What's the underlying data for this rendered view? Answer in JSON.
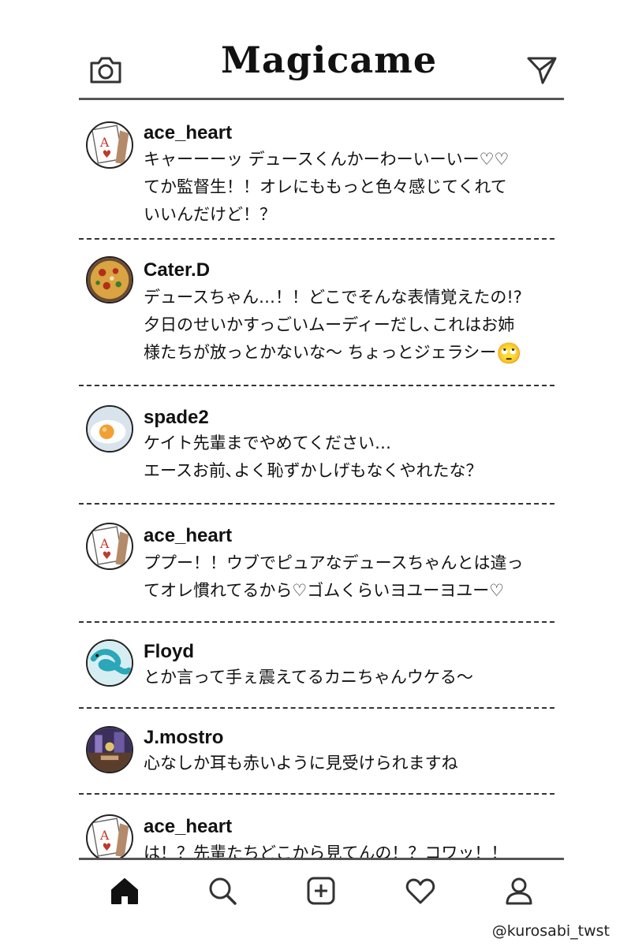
{
  "app": {
    "logo_text": "Magicame"
  },
  "header": {
    "camera_icon": "camera-icon",
    "send_icon": "paper-plane-icon"
  },
  "posts": [
    {
      "username": "ace_heart",
      "avatar": "ace-of-hearts-card-avatar",
      "lines": [
        "キャーーーッ デュースくんかーわーいーいー♡♡",
        "てか監督生！！オレにももっと色々感じてくれて",
        "いいんだけど！？"
      ]
    },
    {
      "username": "Cater.D",
      "avatar": "pizza-avatar",
      "lines": [
        "デュースちゃん…！！どこでそんな表情覚えたの!?",
        "夕日のせいかすっごいムーディーだし､これはお姉",
        "様たちが放っとかないな〜 ちょっとジェラシー"
      ],
      "emoji": "🙄"
    },
    {
      "username": "spade2",
      "avatar": "fried-egg-avatar",
      "lines": [
        "ケイト先輩までやめてください…",
        "エースお前､よく恥ずかしげもなくやれたな？"
      ]
    },
    {
      "username": "ace_heart",
      "avatar": "ace-of-hearts-card-avatar",
      "lines": [
        "ププー！！ウブでピュアなデュースちゃんとは違っ",
        "てオレ慣れてるから♡ゴムくらいヨユーヨユー♡"
      ]
    },
    {
      "username": "Floyd",
      "avatar": "eel-avatar",
      "lines": [
        "とか言って手ぇ震えてるカニちゃんウケる〜"
      ]
    },
    {
      "username": "J.mostro",
      "avatar": "lounge-interior-avatar",
      "lines": [
        "心なしか耳も赤いように見受けられますね"
      ]
    },
    {
      "username": "ace_heart",
      "avatar": "ace-of-hearts-card-avatar",
      "lines": [
        "は！？先輩たちどこから見てんの！？コワッ！！"
      ]
    }
  ],
  "nav": {
    "items": [
      {
        "name": "home",
        "icon": "home-icon",
        "active": true
      },
      {
        "name": "search",
        "icon": "search-icon",
        "active": false
      },
      {
        "name": "new-post",
        "icon": "plus-square-icon",
        "active": false
      },
      {
        "name": "activity",
        "icon": "heart-icon",
        "active": false
      },
      {
        "name": "profile",
        "icon": "user-icon",
        "active": false
      }
    ]
  },
  "credit": "@kurosabi_twst"
}
